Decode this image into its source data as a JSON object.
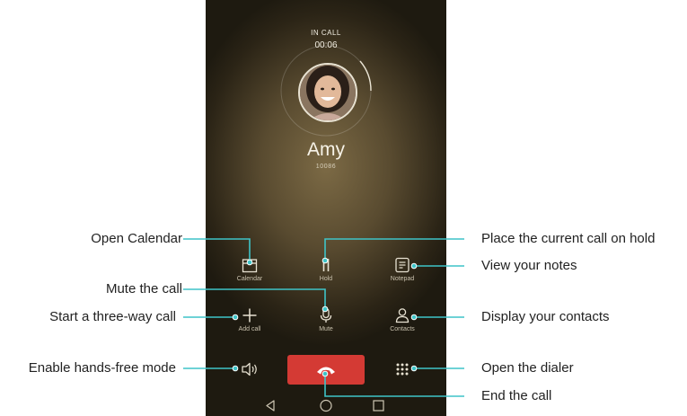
{
  "call": {
    "status": "IN CALL",
    "timer": "00:06",
    "name": "Amy",
    "number": "10086"
  },
  "controls": {
    "calendar": "Calendar",
    "hold": "Hold",
    "notepad": "Notepad",
    "add_call": "Add call",
    "mute": "Mute",
    "contacts": "Contacts"
  },
  "annotations": {
    "open_calendar": "Open Calendar",
    "mute_call": "Mute the call",
    "three_way": "Start a three-way call",
    "hands_free": "Enable hands-free mode",
    "hold": "Place the current call on hold",
    "notes": "View your notes",
    "contacts": "Display your contacts",
    "dialer": "Open the dialer",
    "end_call": "End the call"
  },
  "colors": {
    "accent_cyan": "#3ec4c8",
    "end_call_red": "#d43a34"
  },
  "icons": [
    "calendar-icon",
    "hold-icon",
    "notepad-icon",
    "add-call-icon",
    "microphone-icon",
    "contacts-icon",
    "speaker-icon",
    "phone-hangup-icon",
    "dialpad-icon",
    "back-nav-icon",
    "home-nav-icon",
    "recents-nav-icon"
  ]
}
